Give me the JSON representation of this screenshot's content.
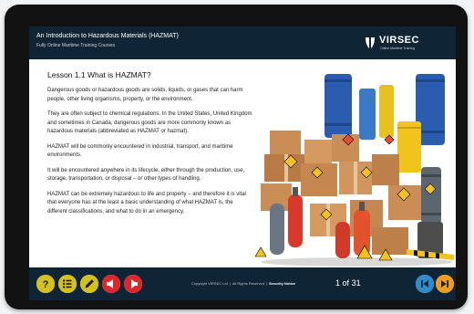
{
  "header": {
    "title": "An Introduction to Hazardous Materials (HAZMAT)",
    "subtitle": "Fully Online Maritime Training Courses",
    "logo_text": "VIRSEC",
    "logo_tagline": "Online Maritime Training"
  },
  "lesson": {
    "title": "Lesson 1.1 What is HAZMAT?",
    "paragraphs": [
      "Dangerous goods or hazardous goods are solids, liquids, or gases that can harm people, other living organisms, property, or the environment.",
      "They are often subject to chemical regulations. In the United States, United Kingdom and sometimes in Canada, dangerous goods are more commonly known as hazardous materials (abbreviated as HAZMAT or hazmat).",
      "HAZMAT will be commonly encountered in industrial, transport, and maritime environments.",
      "It will be encountered anywhere in its lifecycle, either through the production, use, storage, transportation, or disposal – or other types of handling.",
      "HAZMAT can be extremely hazardous to life and property – and therefore it is vital that everyone has at the least a basic understanding of what HAZMAT is, the different classifications, and what to do in an emergency."
    ]
  },
  "footer": {
    "buttons": [
      {
        "name": "help-icon",
        "glyph": "?",
        "color": "#d4c21a"
      },
      {
        "name": "menu-list-icon",
        "color": "#d4c21a"
      },
      {
        "name": "pencil-icon",
        "color": "#d4c21a"
      },
      {
        "name": "audio-left-icon",
        "color": "#e0252b"
      },
      {
        "name": "audio-right-icon",
        "color": "#e0252b"
      }
    ],
    "copyright": "Copyright VIRSEC Ltd",
    "rights": "All Rights Reserved",
    "security_link": "Security Notice",
    "page_current": "1",
    "page_of": "of",
    "page_total": "31",
    "nav_prev_color": "#2f8ccc",
    "nav_next_color": "#f39a1b"
  }
}
